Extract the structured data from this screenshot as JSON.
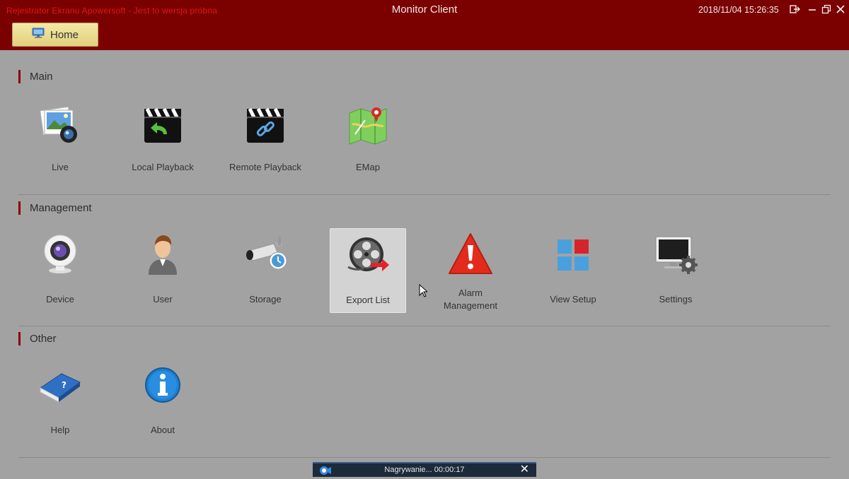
{
  "titlebar": {
    "watermark": "Rejestrator Ekranu Apowersoft - Jest to wersja próbna",
    "title": "Monitor Client",
    "datetime": "2018/11/04 15:26:35",
    "home_label": "Home",
    "controls": [
      "logout-icon",
      "minimize-icon",
      "restore-icon",
      "close-icon"
    ]
  },
  "sections": [
    {
      "title": "Main",
      "items": [
        {
          "label": "Live",
          "icon": "live-photo-icon"
        },
        {
          "label": "Local Playback",
          "icon": "clapperboard-playback-icon"
        },
        {
          "label": "Remote Playback",
          "icon": "clapperboard-link-icon"
        },
        {
          "label": "EMap",
          "icon": "map-icon"
        }
      ]
    },
    {
      "title": "Management",
      "items": [
        {
          "label": "Device",
          "icon": "webcam-icon"
        },
        {
          "label": "User",
          "icon": "user-icon"
        },
        {
          "label": "Storage",
          "icon": "security-camera-icon"
        },
        {
          "label": "Export List",
          "icon": "film-reel-export-icon",
          "state": "hover"
        },
        {
          "label": "Alarm\nManagement",
          "icon": "warning-icon"
        },
        {
          "label": "View Setup",
          "icon": "grid-view-icon"
        },
        {
          "label": "Settings",
          "icon": "monitor-gear-icon"
        }
      ]
    },
    {
      "title": "Other",
      "items": [
        {
          "label": "Help",
          "icon": "help-book-icon"
        },
        {
          "label": "About",
          "icon": "info-icon"
        }
      ]
    }
  ],
  "recording": {
    "text": "Nagrywanie...  00:00:17",
    "close": "✕"
  },
  "colors": {
    "titlebar": "#7b0000",
    "background": "#a2a2a2",
    "section_accent": "#8b0000",
    "home_button": "#ecdc92"
  }
}
